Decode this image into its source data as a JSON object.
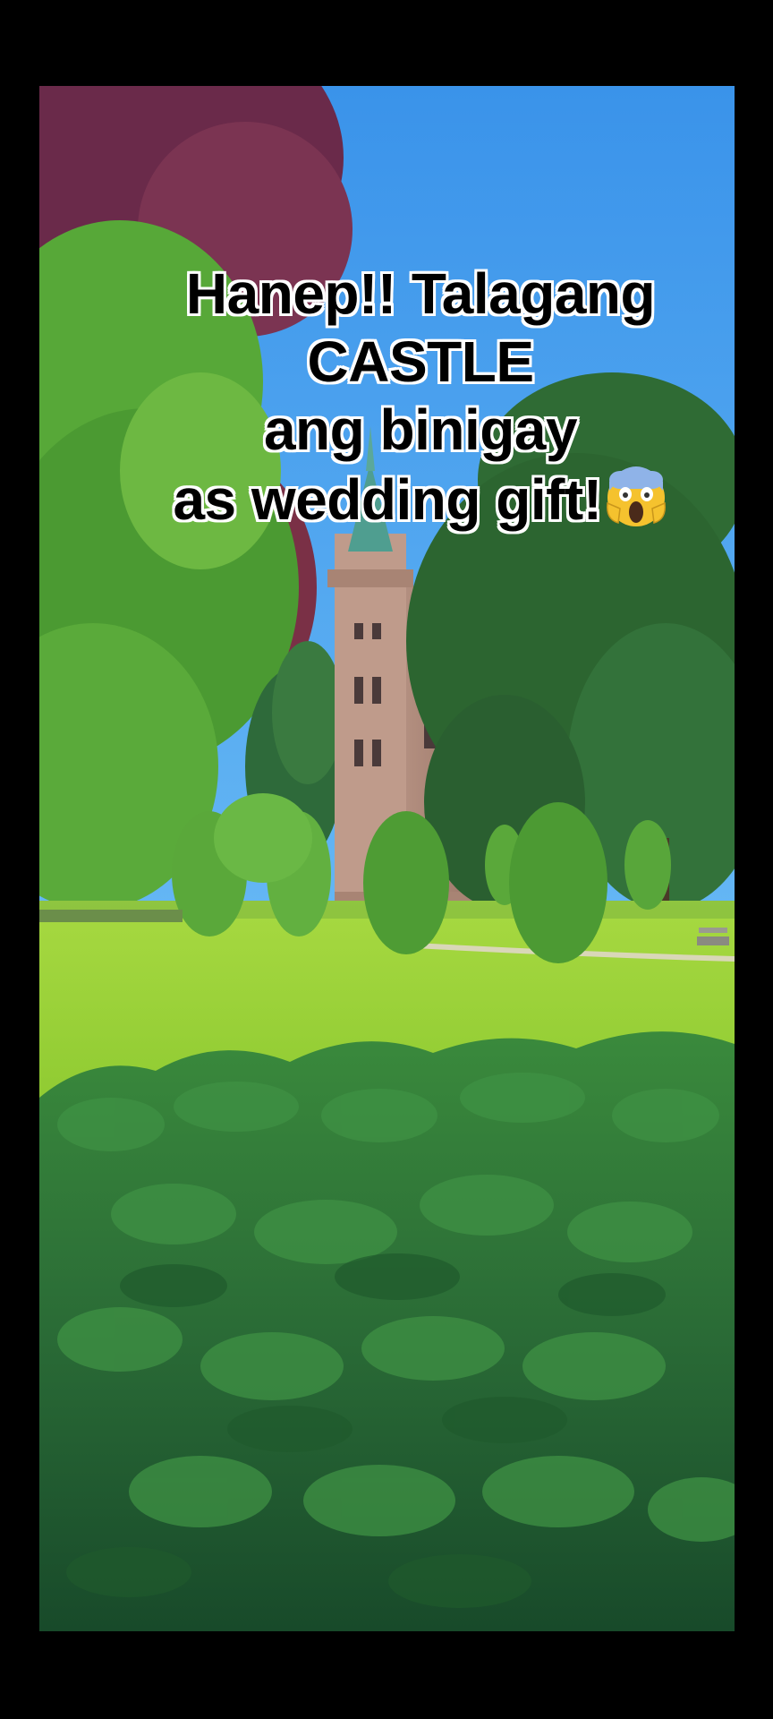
{
  "caption": {
    "line1": "Hanep!! Talagang",
    "line2": "CASTLE",
    "line3": "ang binigay",
    "line4": "as wedding gift!",
    "emoji": "face-screaming-in-fear-icon"
  },
  "scene": {
    "subject": "castle-tower",
    "colors": {
      "sky": "#3aa0ee",
      "lawn": "#9fd43a",
      "hedge": "#2f7a3a",
      "castle": "#b58f7e",
      "letterbox": "#000000"
    }
  }
}
